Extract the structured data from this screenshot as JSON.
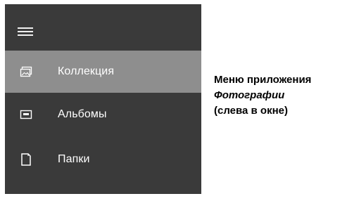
{
  "menu": {
    "hamburger_icon": "hamburger-menu-icon",
    "items": [
      {
        "label": "Коллекция",
        "icon": "photo-collection-icon",
        "selected": true
      },
      {
        "label": "Альбомы",
        "icon": "album-icon",
        "selected": false
      },
      {
        "label": "Папки",
        "icon": "folder-icon",
        "selected": false
      }
    ]
  },
  "caption": {
    "line1": "Меню приложения",
    "line2": "Фотографии",
    "line3": "(слева в окне)"
  },
  "colors": {
    "panel_background": "#3a3a3a",
    "selected_background": "#8e8e8e",
    "menu_text": "#ffffff",
    "caption_text": "#000000"
  }
}
